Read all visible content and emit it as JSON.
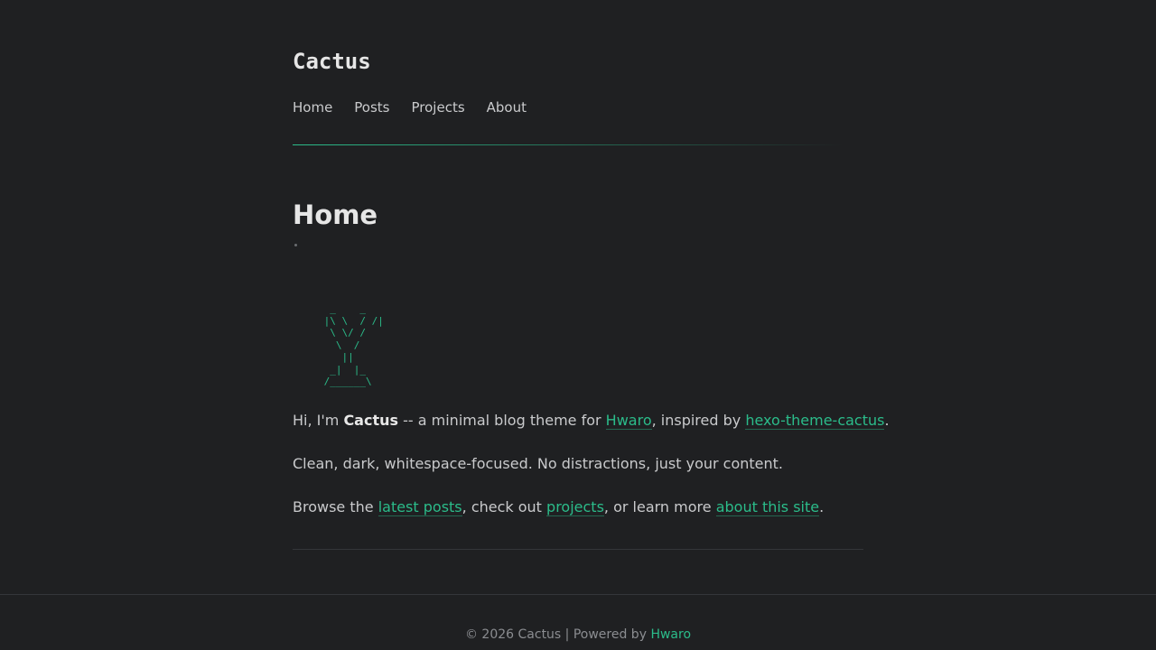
{
  "site": {
    "title": "Cactus"
  },
  "nav": {
    "items": [
      {
        "label": "Home"
      },
      {
        "label": "Posts"
      },
      {
        "label": "Projects"
      },
      {
        "label": "About"
      }
    ]
  },
  "page": {
    "title": "Home",
    "ascii_art": "  _    _\n |\\ \\  / /|\n  \\ \\/ /\n   \\  /\n    ||\n  _|  |_\n /______\\",
    "paragraphs": {
      "p1": {
        "t1": "Hi, I'm ",
        "bold": "Cactus",
        "t2": " -- a minimal blog theme for ",
        "link1": "Hwaro",
        "t3": ", inspired by ",
        "link2": "hexo-theme-cactus",
        "t4": "."
      },
      "p2": {
        "text": "Clean, dark, whitespace-focused. No distractions, just your content."
      },
      "p3": {
        "t1": "Browse the ",
        "link1": "latest posts",
        "t2": ", check out ",
        "link2": "projects",
        "t3": ", or learn more ",
        "link3": "about this site",
        "t4": "."
      }
    }
  },
  "footer": {
    "text": "© 2026 Cactus | Powered by ",
    "link": "Hwaro"
  },
  "colors": {
    "background": "#1f2022",
    "accent": "#2bbc8a",
    "text": "#c9cacc",
    "heading": "#e6e6e6",
    "muted": "#8b8d91"
  }
}
